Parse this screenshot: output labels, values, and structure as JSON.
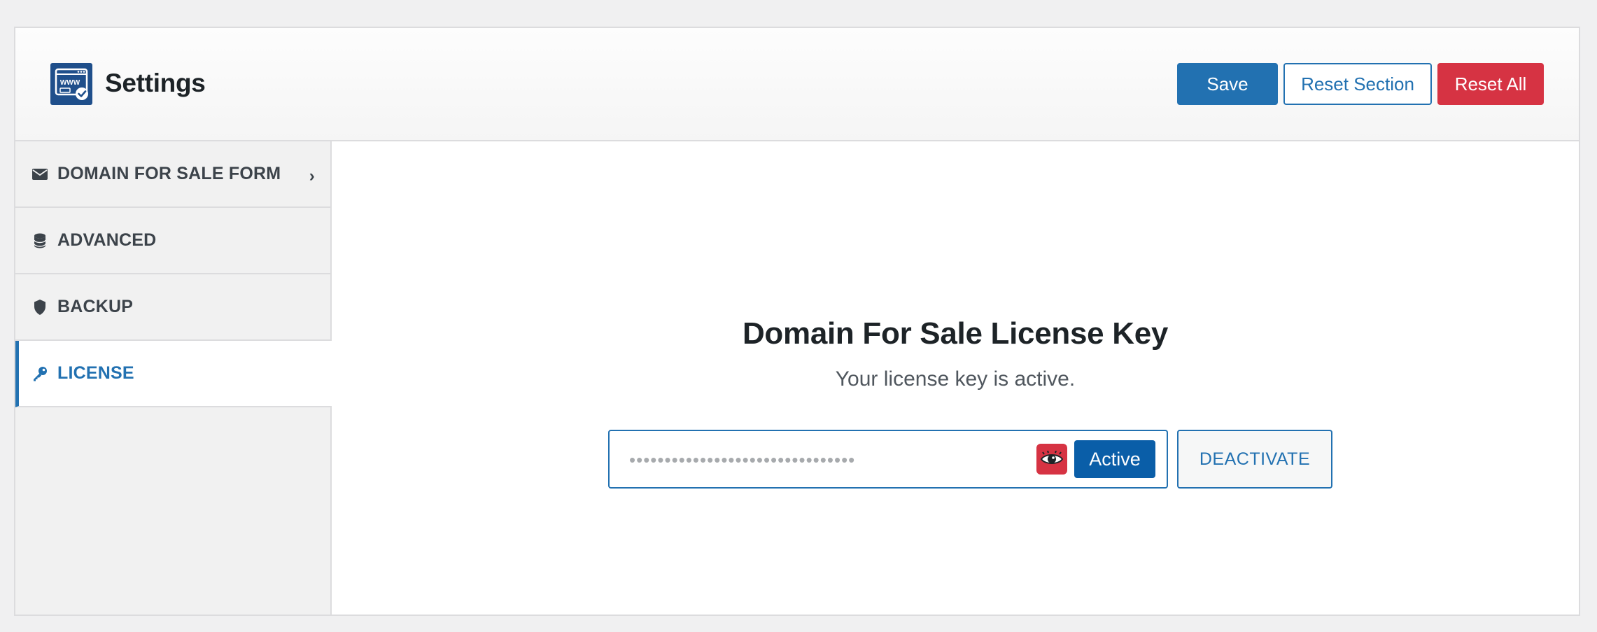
{
  "header": {
    "title": "Settings",
    "logo_icon": "www-domain-check-icon",
    "logo_text": "WWW",
    "buttons": {
      "save": "Save",
      "reset_section": "Reset Section",
      "reset_all": "Reset All"
    }
  },
  "sidebar": {
    "items": [
      {
        "label": "DOMAIN FOR SALE FORM",
        "icon": "envelope-icon",
        "has_chevron": true,
        "active": false
      },
      {
        "label": "ADVANCED",
        "icon": "database-icon",
        "active": false
      },
      {
        "label": "BACKUP",
        "icon": "shield-icon",
        "active": false
      },
      {
        "label": "LICENSE",
        "icon": "key-icon",
        "active": true
      }
    ],
    "chevron": "›"
  },
  "license": {
    "title": "Domain For Sale License Key",
    "status_text": "Your license key is active.",
    "masked_key": "••••••••••••••••••••••••••••••••",
    "toggle_icon": "eye-icon",
    "badge": "Active",
    "deactivate_label": "DEACTIVATE"
  },
  "colors": {
    "primary": "#2271b1",
    "danger": "#d63343",
    "badge": "#0a5ea8",
    "logo": "#1f4f8b"
  }
}
